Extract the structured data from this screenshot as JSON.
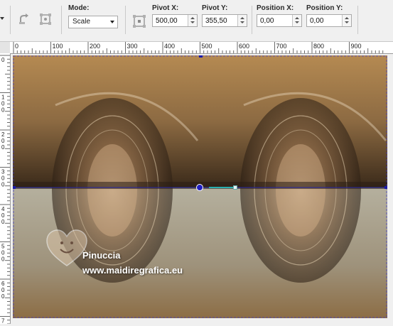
{
  "toolbar": {
    "mode": {
      "label": "Mode:",
      "value": "Scale"
    },
    "pivot_x": {
      "label": "Pivot X:",
      "value": "500,00"
    },
    "pivot_y": {
      "label": "Pivot Y:",
      "value": "355,50"
    },
    "position_x": {
      "label": "Position X:",
      "value": "0,00"
    },
    "position_y": {
      "label": "Position Y:",
      "value": "0,00"
    }
  },
  "ruler": {
    "horizontal_ticks": [
      "0",
      "100",
      "200",
      "300",
      "400",
      "500",
      "600",
      "700",
      "800",
      "900"
    ],
    "vertical_ticks": [
      "0",
      "1 0 0",
      "2 0 0",
      "3 0 0",
      "4 0 0",
      "5 0 0",
      "6 0 0",
      "7 0 0"
    ]
  },
  "watermark": {
    "name": "Pinuccia",
    "site": "www.maidiregrafica.eu"
  },
  "colors": {
    "toolbar_bg": "#f0f0f0",
    "handle": "#1a1aa8",
    "image_top": "#8a6a3f",
    "image_bottom": "#a29a8a"
  }
}
